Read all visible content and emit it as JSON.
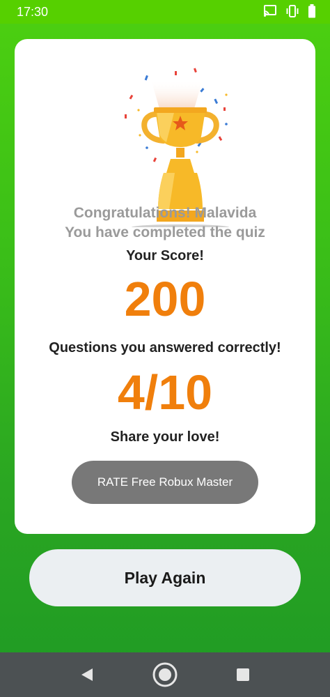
{
  "status_bar": {
    "time": "17:30",
    "icons": [
      "cast-icon",
      "vibrate-icon",
      "battery-icon"
    ]
  },
  "result_card": {
    "congrats_line1": "Congratulations! Malavida",
    "congrats_line2": "You have completed the quiz",
    "score_label": "Your Score!",
    "score_value": "200",
    "questions_label": "Questions you answered correctly!",
    "correct_value": "4/10",
    "share_label": "Share your love!",
    "rate_button_label": "RATE Free Robux Master"
  },
  "actions": {
    "play_again_label": "Play Again"
  },
  "nav_bar": {
    "icons": [
      "back-icon",
      "home-icon",
      "recents-icon"
    ]
  },
  "colors": {
    "background_green": "#3bbf18",
    "accent_orange": "#f07f0c",
    "rate_button_gray": "#787878",
    "play_button_bg": "#ebeff2",
    "trophy_gold": "#f7b928"
  }
}
